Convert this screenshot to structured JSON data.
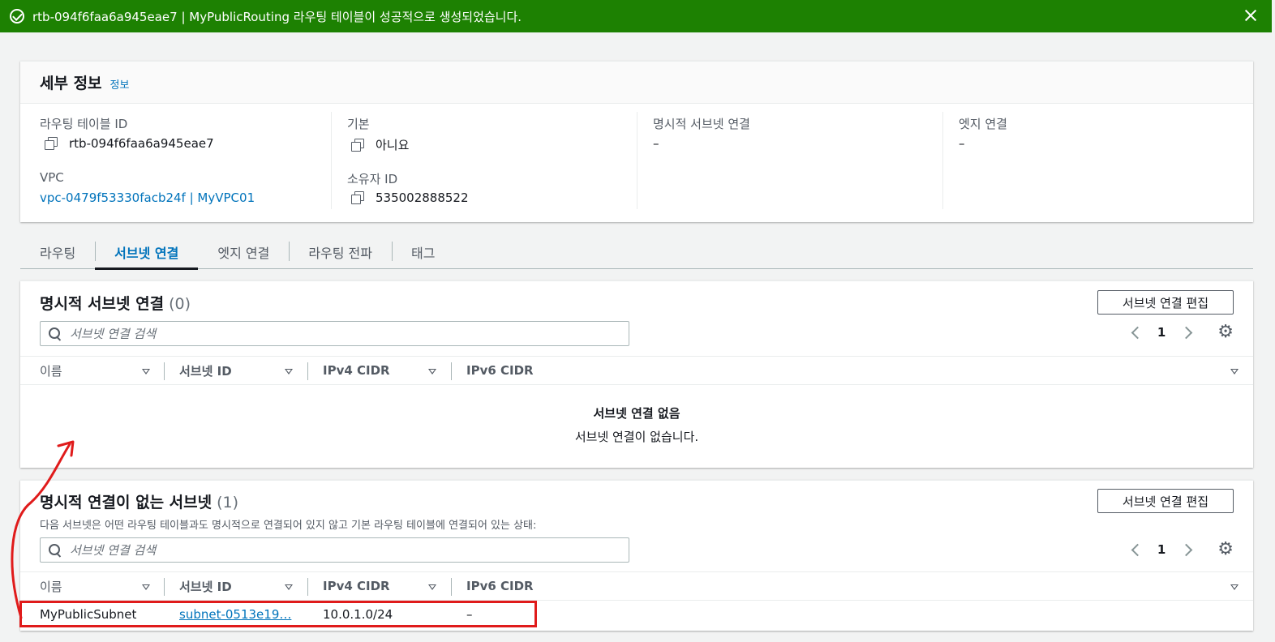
{
  "banner": {
    "rtb_id": "rtb-094f6faa6a945eae7",
    "name": "MyPublicRouting",
    "message_rest": " 라우팅 테이블이 성공적으로 생성되었습니다."
  },
  "details": {
    "title": "세부 정보",
    "info_link": "정보",
    "route_table_id_label": "라우팅 테이블 ID",
    "route_table_id": "rtb-094f6faa6a945eae7",
    "vpc_label": "VPC",
    "vpc_value": "vpc-0479f53330facb24f | MyVPC01",
    "main_label": "기본",
    "main_value": "아니요",
    "owner_label": "소유자 ID",
    "owner_value": "535002888522",
    "explicit_label": "명시적 서브넷 연결",
    "explicit_value": "–",
    "edge_label": "엣지 연결",
    "edge_value": "–"
  },
  "tabs": [
    {
      "label": "라우팅"
    },
    {
      "label": "서브넷 연결"
    },
    {
      "label": "엣지 연결"
    },
    {
      "label": "라우팅 전파"
    },
    {
      "label": "태그"
    }
  ],
  "explicit_panel": {
    "title": "명시적 서브넷 연결",
    "count": "(0)",
    "edit_button": "서브넷 연결 편집",
    "search_placeholder": "서브넷 연결 검색",
    "page": "1",
    "columns": [
      "이름",
      "서브넷 ID",
      "IPv4 CIDR",
      "IPv6 CIDR"
    ],
    "empty_title": "서브넷 연결 없음",
    "empty_desc": "서브넷 연결이 없습니다."
  },
  "implicit_panel": {
    "title": "명시적 연결이 없는 서브넷",
    "count": "(1)",
    "description": "다음 서브넷은 어떤 라우팅 테이블과도 명시적으로 연결되어 있지 않고 기본 라우팅 테이블에 연결되어 있는 상태:",
    "edit_button": "서브넷 연결 편집",
    "search_placeholder": "서브넷 연결 검색",
    "page": "1",
    "columns": [
      "이름",
      "서브넷 ID",
      "IPv4 CIDR",
      "IPv6 CIDR"
    ],
    "rows": [
      {
        "name": "MyPublicSubnet",
        "subnet_id": "subnet-0513e19…",
        "ipv4": "10.0.1.0/24",
        "ipv6": "–"
      }
    ]
  },
  "colors": {
    "success": "#1d8102",
    "link": "#0073bb",
    "annotation": "#e01b1b"
  }
}
